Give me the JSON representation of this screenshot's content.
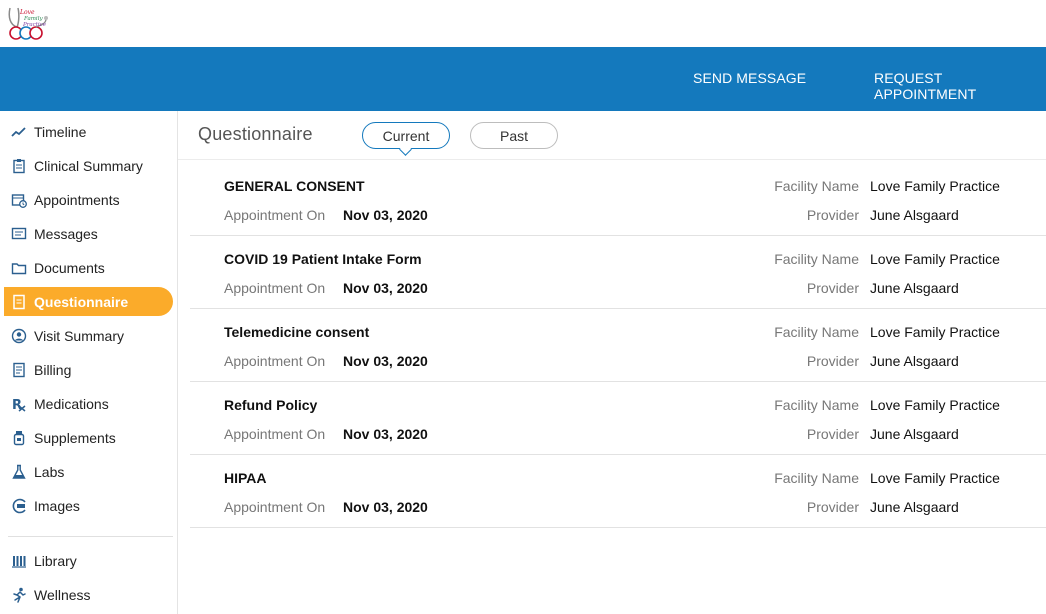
{
  "header": {
    "logo_alt": "Love Family Practice",
    "send_message": "SEND MESSAGE",
    "request_appointment": "REQUEST APPOINTMENT"
  },
  "sidebar": {
    "items": [
      {
        "label": "Timeline",
        "icon": "trend-line-icon"
      },
      {
        "label": "Clinical Summary",
        "icon": "clipboard-icon"
      },
      {
        "label": "Appointments",
        "icon": "calendar-clock-icon"
      },
      {
        "label": "Messages",
        "icon": "message-icon"
      },
      {
        "label": "Documents",
        "icon": "folder-icon"
      },
      {
        "label": "Questionnaire",
        "icon": "form-icon",
        "active": true
      },
      {
        "label": "Visit Summary",
        "icon": "user-circle-icon"
      },
      {
        "label": "Billing",
        "icon": "receipt-icon"
      },
      {
        "label": "Medications",
        "icon": "rx-icon"
      },
      {
        "label": "Supplements",
        "icon": "bottle-icon"
      },
      {
        "label": "Labs",
        "icon": "flask-icon"
      },
      {
        "label": "Images",
        "icon": "images-icon"
      }
    ],
    "bottom_items": [
      {
        "label": "Library",
        "icon": "library-icon"
      },
      {
        "label": "Wellness",
        "icon": "running-icon"
      }
    ]
  },
  "main": {
    "title": "Questionnaire",
    "tabs": [
      {
        "label": "Current",
        "selected": true
      },
      {
        "label": "Past",
        "selected": false
      }
    ],
    "field_labels": {
      "appointment_on": "Appointment On",
      "facility_name": "Facility Name",
      "provider": "Provider"
    },
    "rows": [
      {
        "name": "GENERAL CONSENT",
        "appointment_on": "Nov 03, 2020",
        "facility_name": "Love Family Practice",
        "provider": "June Alsgaard"
      },
      {
        "name": "COVID 19 Patient Intake Form",
        "appointment_on": "Nov 03, 2020",
        "facility_name": "Love Family Practice",
        "provider": "June Alsgaard"
      },
      {
        "name": "Telemedicine consent",
        "appointment_on": "Nov 03, 2020",
        "facility_name": "Love Family Practice",
        "provider": "June Alsgaard"
      },
      {
        "name": "Refund Policy",
        "appointment_on": "Nov 03, 2020",
        "facility_name": "Love Family Practice",
        "provider": "June Alsgaard"
      },
      {
        "name": "HIPAA",
        "appointment_on": "Nov 03, 2020",
        "facility_name": "Love Family Practice",
        "provider": "June Alsgaard"
      }
    ]
  },
  "colors": {
    "brand_blue": "#1479bd",
    "active_orange": "#fbab2a",
    "icon_blue": "#2b5f8f"
  }
}
